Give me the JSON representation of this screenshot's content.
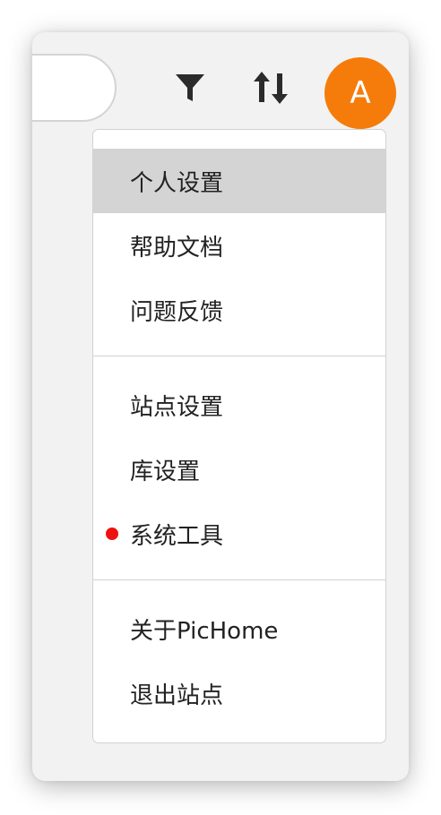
{
  "header": {
    "avatar_initial": "A",
    "icons": [
      "filter-icon",
      "sort-icon"
    ]
  },
  "colors": {
    "avatar_bg": "#f57c0a",
    "active_item_bg": "#d4d4d4",
    "badge": "#ee1111"
  },
  "menu": {
    "items": [
      {
        "label": "个人设置",
        "active": true
      },
      {
        "label": "帮助文档"
      },
      {
        "label": "问题反馈"
      },
      {
        "label": "站点设置"
      },
      {
        "label": "库设置"
      },
      {
        "label": "系统工具",
        "has_badge": true
      },
      {
        "label": "关于PicHome"
      },
      {
        "label": "退出站点"
      }
    ]
  }
}
